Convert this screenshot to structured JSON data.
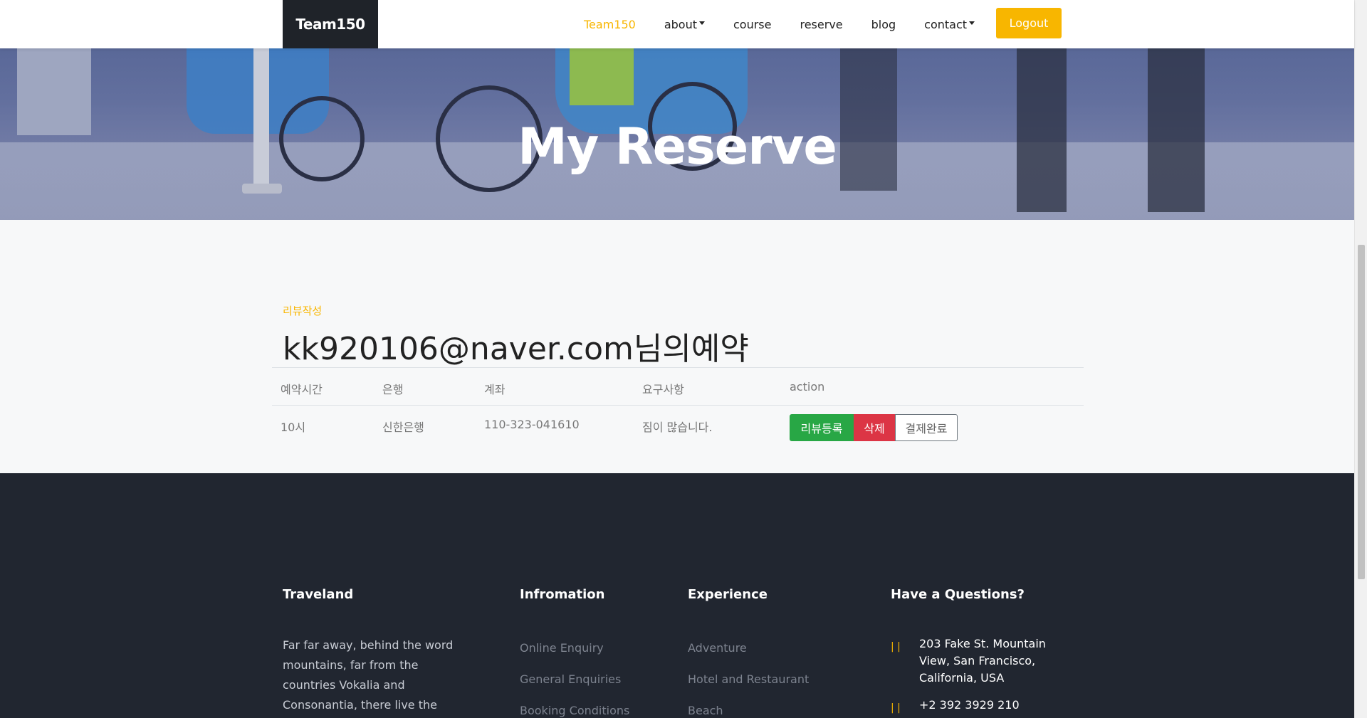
{
  "nav": {
    "brand": "Team150",
    "items": [
      {
        "label": "Team150",
        "active": true,
        "dropdown": false
      },
      {
        "label": "about",
        "active": false,
        "dropdown": true
      },
      {
        "label": "course",
        "active": false,
        "dropdown": false
      },
      {
        "label": "reserve",
        "active": false,
        "dropdown": false
      },
      {
        "label": "blog",
        "active": false,
        "dropdown": false
      },
      {
        "label": "contact",
        "active": false,
        "dropdown": true
      }
    ],
    "logout_label": "Logout"
  },
  "hero": {
    "title": "My Reserve"
  },
  "content": {
    "subheading": "리뷰작성",
    "heading": "kk920106@naver.com님의예약",
    "table": {
      "columns": [
        "예약시간",
        "은행",
        "계좌",
        "요구사항",
        "action"
      ],
      "rows": [
        {
          "time": "10시",
          "bank": "신한은행",
          "account": "110-323-041610",
          "request": "짐이 많습니다."
        }
      ],
      "actions": {
        "review": "리뷰등록",
        "delete": "삭제",
        "paid": "결제완료"
      }
    }
  },
  "footer": {
    "about": {
      "title": "Traveland",
      "text": "Far far away, behind the word mountains, far from the countries Vokalia and Consonantia, there live the"
    },
    "information": {
      "title": "Infromation",
      "links": [
        "Online Enquiry",
        "General Enquiries",
        "Booking Conditions"
      ]
    },
    "experience": {
      "title": "Experience",
      "links": [
        "Adventure",
        "Hotel and Restaurant",
        "Beach"
      ]
    },
    "contact": {
      "title": "Have a Questions?",
      "address": "203 Fake St. Mountain View, San Francisco, California, USA",
      "phone": "+2 392 3929 210"
    }
  },
  "colors": {
    "accent": "#f8b600",
    "dark": "#212630",
    "success": "#28a745",
    "danger": "#dc3545"
  }
}
